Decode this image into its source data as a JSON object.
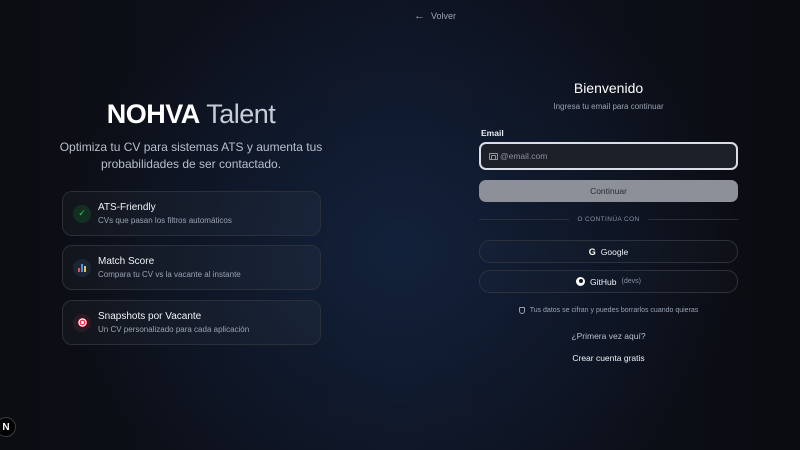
{
  "nav": {
    "back_label": "Volver"
  },
  "brand": {
    "name_bold": "NOHVA",
    "name_light": "Talent",
    "tagline": "Optimiza tu CV para sistemas ATS y aumenta tus probabilidades de ser contactado."
  },
  "features": [
    {
      "icon": "check-icon",
      "title": "ATS-Friendly",
      "description": "CVs que pasan los filtros automáticos"
    },
    {
      "icon": "bar-chart-icon",
      "title": "Match Score",
      "description": "Compara tu CV vs la vacante al instante"
    },
    {
      "icon": "target-icon",
      "title": "Snapshots por Vacante",
      "description": "Un CV personalizado para cada aplicación"
    }
  ],
  "login": {
    "title": "Bienvenido",
    "subtitle": "Ingresa tu email para continuar",
    "email_label": "Email",
    "email_placeholder": "@email.com",
    "email_value": "",
    "continue_label": "Continuar",
    "divider_text": "O CONTINÚA CON",
    "google_label": "Google",
    "github_label": "GitHub",
    "github_note": "(devs)",
    "privacy_text": "Tus datos se cifran y puedes borrarlos cuando quieras",
    "first_time_text": "¿Primera vez aquí?",
    "create_account_label": "Crear cuenta gratis"
  },
  "dev_badge": {
    "label": "N"
  },
  "colors": {
    "background": "#0b0d12",
    "continue_button": "#8e9099",
    "check_green": "#35c56a",
    "input_border": "#d9dde6"
  }
}
